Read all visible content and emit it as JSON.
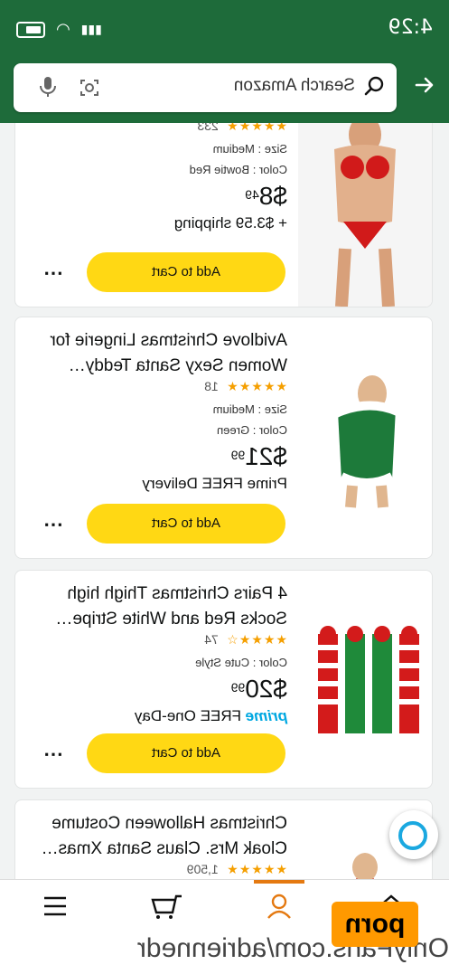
{
  "status": {
    "time": "4:29"
  },
  "search": {
    "placeholder": "Search Amazon"
  },
  "products": [
    {
      "title": "",
      "stars": "★★★★★",
      "rating_count": "233",
      "size": "Size : Medium",
      "color": "Color : Bowtie Red",
      "price_whole": "$8",
      "price_fraction": "49",
      "shipping": "+ $3.59 shipping",
      "add_to_cart": "Add to Cart"
    },
    {
      "title": "Avidlove Christmas Lingerie for Women Sexy Santa Teddy…",
      "stars": "★★★★★",
      "rating_count": "18",
      "size": "Size : Medium",
      "color": "Color : Green",
      "price_whole": "$21",
      "price_fraction": "99",
      "shipping": "Prime FREE Delivery",
      "add_to_cart": "Add to Cart"
    },
    {
      "title": "4 Pairs Christmas Thigh high Socks Red and White Stripe…",
      "stars": "★★★★☆",
      "rating_count": "74",
      "color": "Color : Cute Style",
      "price_whole": "$20",
      "price_fraction": "99",
      "prime_label": "prime",
      "shipping": "FREE One-Day",
      "add_to_cart": "Add to Cart"
    },
    {
      "title": "Christmas Halloween Costume Cloak Mrs. Claus Santa Xmas…",
      "stars": "★★★★★",
      "rating_count": "1,509"
    }
  ],
  "watermark": {
    "text": "OnlyFans.com/adriennedr",
    "logo": "porn"
  },
  "colors": {
    "header": "#1e6b3a",
    "cart_button": "#ffd814",
    "stars": "#f59f00",
    "prime": "#00a8e1"
  }
}
